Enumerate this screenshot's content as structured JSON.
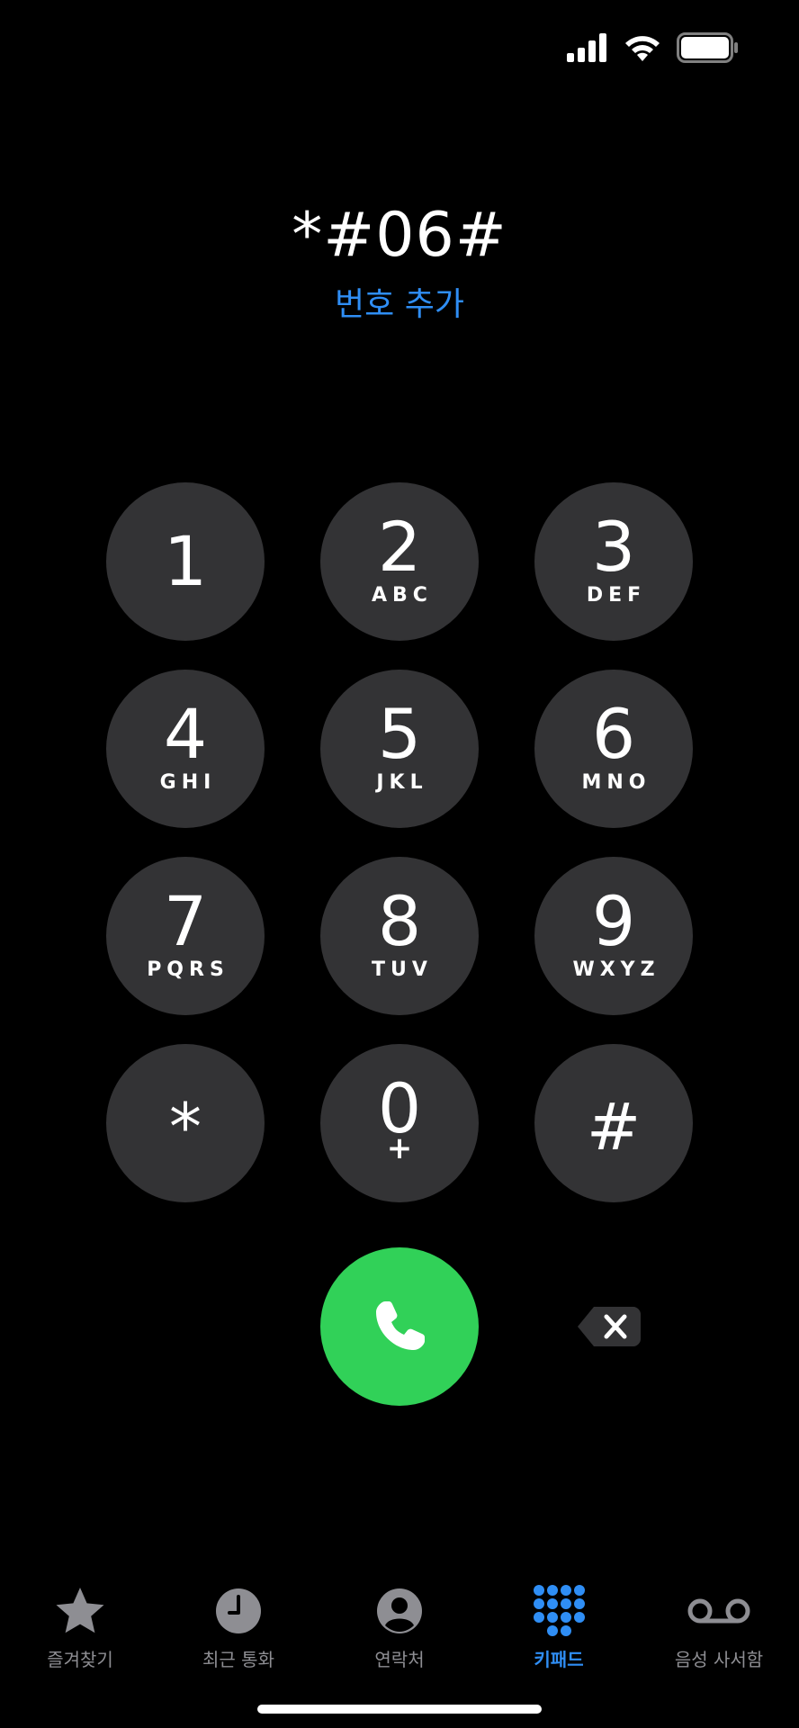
{
  "status_bar": {
    "signal_icon": "cellular-signal-icon",
    "wifi_icon": "wifi-icon",
    "battery_icon": "battery-icon",
    "battery_level": 1.0
  },
  "dialer": {
    "number": "*#06#",
    "add_number_label": "번호 추가"
  },
  "keypad": {
    "keys": [
      {
        "digit": "1",
        "letters": ""
      },
      {
        "digit": "2",
        "letters": "ABC"
      },
      {
        "digit": "3",
        "letters": "DEF"
      },
      {
        "digit": "4",
        "letters": "GHI"
      },
      {
        "digit": "5",
        "letters": "JKL"
      },
      {
        "digit": "6",
        "letters": "MNO"
      },
      {
        "digit": "7",
        "letters": "PQRS"
      },
      {
        "digit": "8",
        "letters": "TUV"
      },
      {
        "digit": "9",
        "letters": "WXYZ"
      },
      {
        "digit": "*",
        "letters": ""
      },
      {
        "digit": "0",
        "letters": "+"
      },
      {
        "digit": "#",
        "letters": ""
      }
    ]
  },
  "actions": {
    "call_icon": "phone-icon",
    "delete_icon": "backspace-icon"
  },
  "tab_bar": {
    "tabs": [
      {
        "label": "즐겨찾기",
        "icon": "star-icon",
        "active": false
      },
      {
        "label": "최근 통화",
        "icon": "clock-icon",
        "active": false
      },
      {
        "label": "연락처",
        "icon": "person-icon",
        "active": false
      },
      {
        "label": "키패드",
        "icon": "keypad-icon",
        "active": true
      },
      {
        "label": "음성 사서함",
        "icon": "voicemail-icon",
        "active": false
      }
    ]
  },
  "colors": {
    "background": "#000000",
    "key_background": "#333335",
    "call_green": "#31d158",
    "accent_blue": "#2f8ef5",
    "inactive_gray": "#8e8e93"
  }
}
